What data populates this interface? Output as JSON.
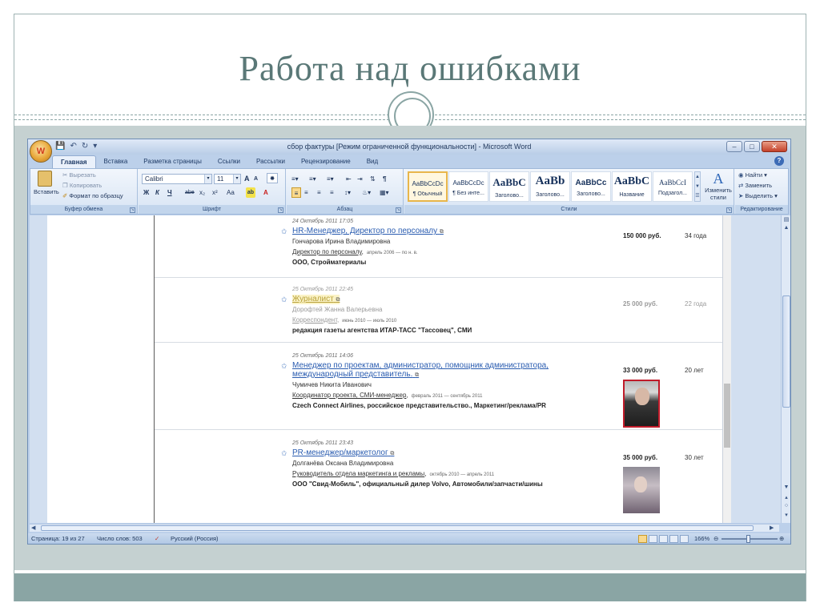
{
  "slide": {
    "title": "Работа над ошибками"
  },
  "window": {
    "title": "сбор фактуры [Режим ограниченной функциональности] - Microsoft Word",
    "office_button_label": "W",
    "controls": {
      "minimize": "–",
      "maximize": "□",
      "close": "✕"
    }
  },
  "ribbon": {
    "tabs": [
      "Главная",
      "Вставка",
      "Разметка страницы",
      "Ссылки",
      "Рассылки",
      "Рецензирование",
      "Вид"
    ],
    "clipboard": {
      "paste": "Вставить",
      "cut": "Вырезать",
      "copy": "Копировать",
      "format_painter": "Формат по образцу",
      "label": "Буфер обмена"
    },
    "font": {
      "font_name": "Calibri",
      "font_size": "11",
      "label": "Шрифт",
      "bold": "Ж",
      "italic": "К",
      "underline": "Ч",
      "strike": "abe",
      "subscript": "x₂",
      "superscript": "x²",
      "change_case": "Aa",
      "grow": "A",
      "shrink": "A"
    },
    "paragraph": {
      "label": "Абзац"
    },
    "styles": {
      "label": "Стили",
      "items": [
        {
          "sample": "AaBbCcDc",
          "name": "¶ Обычный"
        },
        {
          "sample": "AaBbCcDc",
          "name": "¶ Без инте..."
        },
        {
          "sample": "AaBbC",
          "name": "Заголово..."
        },
        {
          "sample": "AaBb",
          "name": "Заголово..."
        },
        {
          "sample": "AaBbCc",
          "name": "Заголово..."
        },
        {
          "sample": "AaBbC",
          "name": "Название"
        },
        {
          "sample": "AaBbCcI",
          "name": "Подзагол..."
        }
      ],
      "change_styles": "Изменить стили"
    },
    "editing": {
      "label": "Редактирование",
      "find": "Найти",
      "replace": "Заменить",
      "select": "Выделить"
    }
  },
  "entries": [
    {
      "date": "24 Октябрь 2011 17:05",
      "title": "HR-Менеджер, Директор по персоналу",
      "name": "Гончарова Ирина Владимировна",
      "role": "Директор по персоналу",
      "period": "апрель 2006 — по н. в.",
      "company": "ООО, Стройматериалы",
      "salary": "150 000 руб.",
      "age": "34 года"
    },
    {
      "date": "25 Октябрь 2011 22:45",
      "title": "Журналист",
      "name": "Дорофтей Жанна Валерьевна",
      "role": "Корреспондент",
      "period": "июнь 2010 — июль 2010",
      "company": "редакция газеты агентства ИТАР-ТАСС \"Тассовец\", СМИ",
      "salary": "25 000 руб.",
      "age": "22 года"
    },
    {
      "date": "25 Октябрь 2011 14:06",
      "title": "Менеджер по проектам, администратор, помощник администратора, международный представитель.",
      "name": "Чумичев Никита Иванович",
      "role": "Координатор проекта, СМИ-менеджер",
      "period": "февраль 2011 — сентябрь 2011",
      "company": "Czech Connect Airlines, российское представительство., Маркетинг/реклама/PR",
      "salary": "33 000 руб.",
      "age": "20 лет"
    },
    {
      "date": "25 Октябрь 2011 23:43",
      "title": "PR-менеджер/маркетолог",
      "name": "Долганёва Оксана Владимировна",
      "role": "Руководитель отдела маркетинга и рекламы",
      "period": "октябрь 2010 — апрель 2011",
      "company": "ООО \"Свид-Мобиль\", официальный дилер Volvo, Автомобили/запчасти/шины",
      "salary": "35 000 руб.",
      "age": "30 лет"
    }
  ],
  "statusbar": {
    "page": "Страница: 19 из 27",
    "words": "Число слов: 503",
    "language": "Русский (Россия)",
    "zoom": "166%"
  }
}
